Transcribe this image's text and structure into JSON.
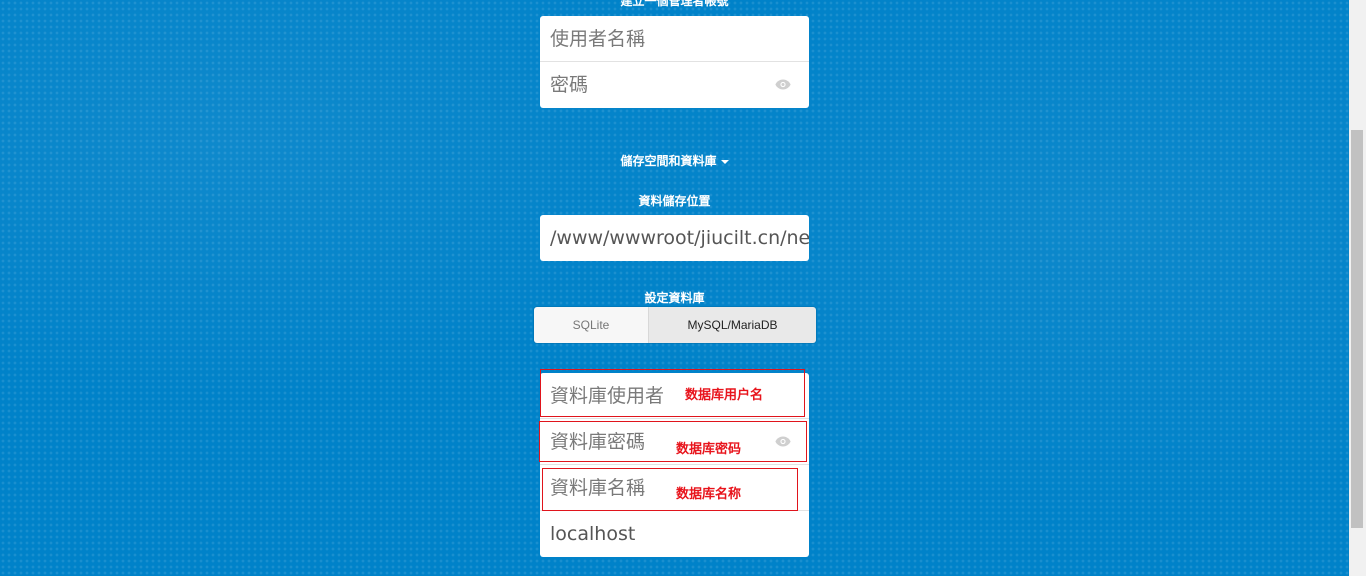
{
  "admin_section": {
    "heading": "建立一個管理者帳號",
    "username_placeholder": "使用者名稱",
    "password_placeholder": "密碼"
  },
  "storage_section": {
    "toggle_label": "儲存空間和資料庫",
    "data_dir_label": "資料儲存位置",
    "data_dir_value": "/www/wwwroot/jiucilt.cn/ne",
    "db_config_label": "設定資料庫",
    "db_options": [
      "SQLite",
      "MySQL/MariaDB"
    ],
    "db_selected": "MySQL/MariaDB"
  },
  "db_fields": {
    "user_placeholder": "資料庫使用者",
    "password_placeholder": "資料庫密碼",
    "name_placeholder": "資料庫名稱",
    "host_value": "localhost"
  },
  "annotations": {
    "user_note": "数据库用户名",
    "password_note": "数据库密码",
    "name_note": "数据库名称",
    "color": "#e8141c"
  },
  "icons": {
    "password_toggle": "eye-icon",
    "storage_toggle": "caret-down-icon"
  },
  "colors": {
    "background": "#0082c9"
  }
}
